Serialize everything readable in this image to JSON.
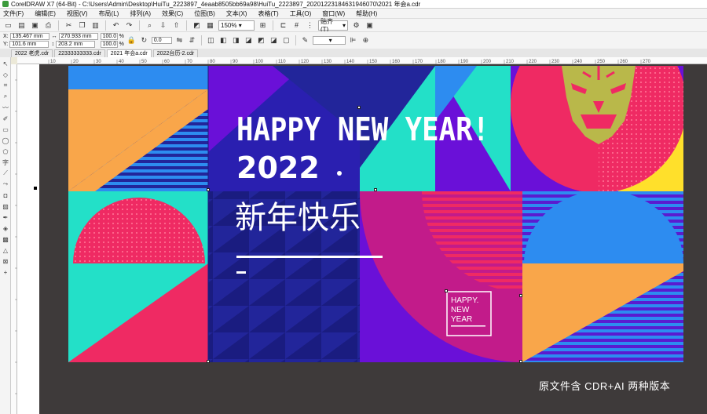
{
  "window": {
    "title": "CorelDRAW X7 (64-Bit) - C:\\Users\\Admin\\Desktop\\HuiTu_2223897_4eaab8505bb69a98\\HuiTu_2223897_20201223184631946070\\2021 年会a.cdr"
  },
  "menu": [
    "文件(F)",
    "编辑(E)",
    "视图(V)",
    "布局(L)",
    "排列(A)",
    "效果(C)",
    "位图(B)",
    "文本(X)",
    "表格(T)",
    "工具(O)",
    "窗口(W)",
    "帮助(H)"
  ],
  "toolbar": {
    "zoom": "150%",
    "snap_label": "贴齐(T)"
  },
  "props": {
    "x_label": "X:",
    "x": "135.467 mm",
    "y_label": "Y:",
    "y": "101.6 mm",
    "w": "270.933 mm",
    "h": "203.2 mm",
    "scale_w": "100.0",
    "scale_h": "100.0",
    "pct": "%",
    "angle": "0.0"
  },
  "tabs": [
    "2022 老虎.cdr",
    "22333333333.cdr",
    "2021 年会a.cdr",
    "2022台历-2.cdr"
  ],
  "active_tab_index": 2,
  "ruler_top": [
    "10",
    "20",
    "30",
    "40",
    "50",
    "60",
    "70",
    "80",
    "90",
    "100",
    "110",
    "120",
    "130",
    "140",
    "150",
    "160",
    "170",
    "180",
    "190",
    "200",
    "210",
    "220",
    "230",
    "240",
    "250",
    "260",
    "270"
  ],
  "artwork": {
    "headline": "HAPPY NEW YEAR!",
    "year": "2022",
    "chinese": "新年快乐",
    "small_1": "HAPPY.",
    "small_2": "NEW",
    "small_3": "YEAR"
  },
  "watermark": "原文件含 CDR+AI 两种版本",
  "colors": {
    "navy": "#22259a",
    "purple": "#6a10d8",
    "orange": "#f9a64a",
    "blue": "#2d8cf0",
    "cyan": "#23e0c8",
    "pink": "#ef2a63",
    "magenta": "#c21b8a",
    "yellow": "#ffe02b",
    "gold": "#b9b84a"
  }
}
